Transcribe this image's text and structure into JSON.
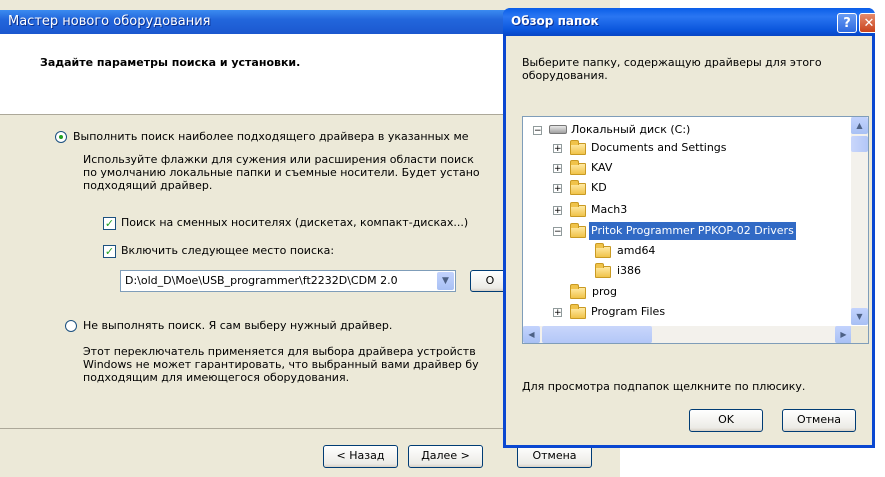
{
  "wizard": {
    "title": "Мастер нового оборудования",
    "header": "Задайте параметры поиска и установки.",
    "option_search": {
      "label": "Выполнить поиск наиболее подходящего драйвера в указанных ме",
      "selected": true,
      "description": [
        "Используйте флажки для сужения или расширения области поиск",
        "по умолчанию локальные папки и съемные носители. Будет устано",
        "подходящий драйвер."
      ]
    },
    "check_removable": {
      "label": "Поиск на сменных носителях (дискетах, компакт-дисках...)",
      "checked": true
    },
    "check_location": {
      "label": "Включить следующее место поиска:",
      "checked": true
    },
    "path_value": "D:\\old_D\\Moe\\USB_programmer\\ft2232D\\CDM 2.0",
    "browse_button_partial": "О",
    "option_manual": {
      "label": "Не выполнять поиск. Я сам выберу нужный драйвер.",
      "selected": false,
      "description": [
        "Этот переключатель применяется для выбора драйвера устройств",
        "Windows не может гарантировать, что выбранный вами драйвер бу",
        "подходящим для имеющегося оборудования."
      ]
    },
    "back_button": "< Назад",
    "next_button": "Далее >",
    "cancel_button": "Отмена"
  },
  "browse": {
    "title": "Обзор папок",
    "help_glyph": "?",
    "close_glyph": "✕",
    "prompt": [
      "Выберите папку, содержащую драйверы для этого",
      "оборудования."
    ],
    "tree": [
      {
        "label": "Локальный диск (C:)",
        "expander": "⊟",
        "icon": "drive-icon"
      },
      {
        "label": "Documents and Settings",
        "expander": "+",
        "icon": "folder-icon"
      },
      {
        "label": "KAV",
        "expander": "+",
        "icon": "folder-icon"
      },
      {
        "label": "KD",
        "expander": "+",
        "icon": "folder-icon"
      },
      {
        "label": "Mach3",
        "expander": "+",
        "icon": "folder-icon"
      },
      {
        "label": "Pritok Programmer PPKOP-02 Drivers",
        "expander": "−",
        "icon": "folder-open-icon",
        "selected": true
      },
      {
        "label": "amd64",
        "expander": "",
        "icon": "folder-icon"
      },
      {
        "label": "i386",
        "expander": "",
        "icon": "folder-icon"
      },
      {
        "label": "prog",
        "expander": "",
        "icon": "folder-icon"
      },
      {
        "label": "Program Files",
        "expander": "+",
        "icon": "folder-icon"
      }
    ],
    "hint": "Для просмотра подпапок щелкните по плюсику.",
    "ok_button": "OK",
    "cancel_button": "Отмена"
  },
  "colors": {
    "title_blue": "#2266dc",
    "selection": "#316ac5",
    "dialog_bg": "#ece9d8"
  }
}
